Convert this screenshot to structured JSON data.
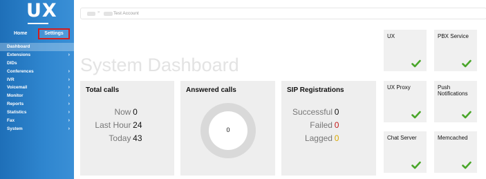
{
  "sidebar": {
    "logo": "UX",
    "home_label": "Home",
    "settings_label": "Settings",
    "items": [
      {
        "label": "Dashboard",
        "active": true,
        "has_submenu": false
      },
      {
        "label": "Extensions",
        "active": false,
        "has_submenu": true
      },
      {
        "label": "DIDs",
        "active": false,
        "has_submenu": false
      },
      {
        "label": "Conferences",
        "active": false,
        "has_submenu": true
      },
      {
        "label": "IVR",
        "active": false,
        "has_submenu": true
      },
      {
        "label": "Voicemail",
        "active": false,
        "has_submenu": true
      },
      {
        "label": "Monitor",
        "active": false,
        "has_submenu": true
      },
      {
        "label": "Reports",
        "active": false,
        "has_submenu": true
      },
      {
        "label": "Statistics",
        "active": false,
        "has_submenu": true
      },
      {
        "label": "Fax",
        "active": false,
        "has_submenu": true
      },
      {
        "label": "System",
        "active": false,
        "has_submenu": true
      }
    ]
  },
  "breadcrumb": {
    "current": "Test Account"
  },
  "page_title": "System Dashboard",
  "total_calls": {
    "title": "Total calls",
    "rows": [
      {
        "label": "Now",
        "value": "0"
      },
      {
        "label": "Last Hour",
        "value": "24"
      },
      {
        "label": "Today",
        "value": "43"
      }
    ]
  },
  "answered_calls": {
    "title": "Answered calls",
    "value": "0"
  },
  "sip_registrations": {
    "title": "SIP Registrations",
    "rows": [
      {
        "label": "Successful",
        "value": "0",
        "color": "#111111"
      },
      {
        "label": "Failed",
        "value": "0",
        "color": "#c31818"
      },
      {
        "label": "Lagged",
        "value": "0",
        "color": "#d9a800"
      }
    ]
  },
  "services": [
    {
      "name": "UX",
      "status": "ok"
    },
    {
      "name": "PBX Service",
      "status": "ok"
    },
    {
      "name": "UX Proxy",
      "status": "ok"
    },
    {
      "name": "Push Notifications",
      "status": "ok"
    },
    {
      "name": "Chat Server",
      "status": "ok"
    },
    {
      "name": "Memcached",
      "status": "ok"
    }
  ],
  "colors": {
    "sidebar": "#2f86cf",
    "check": "#4aa62a",
    "settings_highlight": "#d31b1b"
  }
}
